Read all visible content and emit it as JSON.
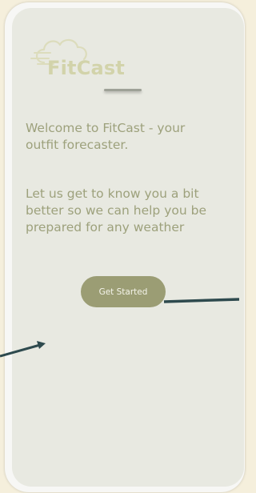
{
  "app": {
    "name": "FitCast"
  },
  "welcome": {
    "heading": "Welcome to FitCast - your outfit forecaster.",
    "body": "Let us get to know you a bit better so we can help you be prepared for any weather"
  },
  "actions": {
    "get_started_label": "Get Started"
  },
  "colors": {
    "page_background": "#f5efdc",
    "screen_background": "#e8e9e1",
    "text": "#9da17c",
    "button": "#9b9d74",
    "logo": "#d2d3aa",
    "annotation_arrow": "#2e4a4e"
  },
  "icons": [
    "cloud-icon",
    "arrow-annotation"
  ]
}
